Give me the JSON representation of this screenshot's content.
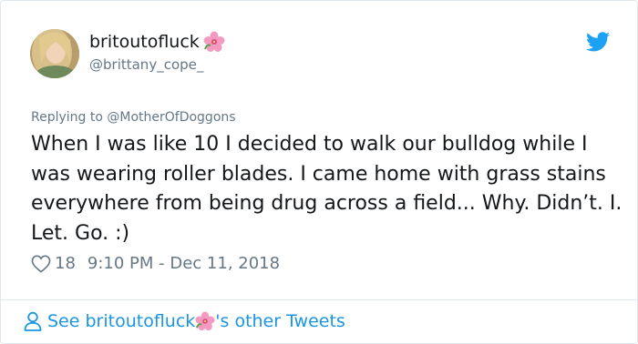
{
  "author": {
    "display_name": "britoutofluck",
    "handle": "@brittany_cope_"
  },
  "reply": {
    "text": "Replying to @MotherOfDoggons"
  },
  "tweet": {
    "text": "When I was like 10 I decided to walk our bulldog while I was wearing roller blades. I came home with grass stains everywhere from being drug across a field... Why. Didn’t. I. Let. Go. :)"
  },
  "meta": {
    "likes": "18",
    "timestamp": "9:10 PM - Dec 11, 2018"
  },
  "footer": {
    "prefix": "See britoutofluck",
    "suffix": "'s other Tweets"
  },
  "icons": {
    "name_emoji": "hibiscus-icon",
    "brand": "twitter-bird-icon",
    "like": "heart-outline-icon",
    "person": "person-icon"
  },
  "colors": {
    "link": "#1b95e0",
    "twitter_blue": "#1da1f2",
    "secondary_text": "#657786",
    "border": "#e1e8ed"
  }
}
